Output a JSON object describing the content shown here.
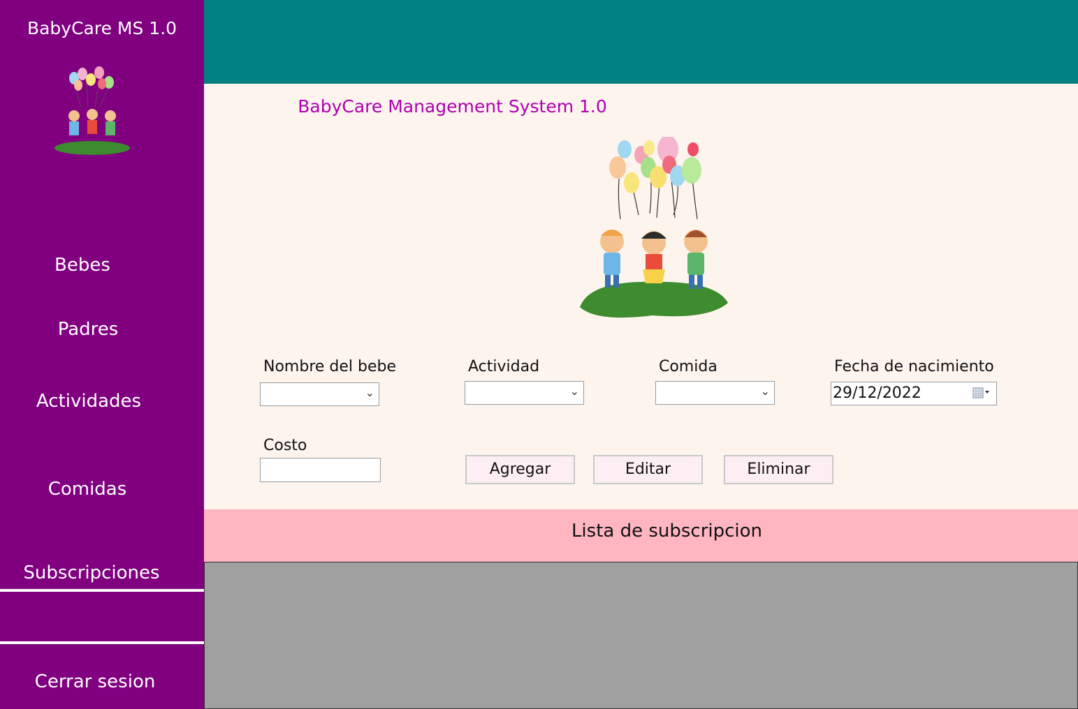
{
  "sidebar": {
    "app_title": "BabyCare MS 1.0",
    "items": [
      {
        "label": "Bebes"
      },
      {
        "label": "Padres"
      },
      {
        "label": "Actividades"
      },
      {
        "label": "Comidas"
      },
      {
        "label": "Subscripciones"
      },
      {
        "label": "Cerrar sesion"
      }
    ]
  },
  "main": {
    "title": "BabyCare Management System 1.0",
    "form": {
      "baby_name_label": "Nombre del bebe",
      "activity_label": "Actividad",
      "food_label": "Comida",
      "birth_date_label": "Fecha de nacimiento",
      "birth_date_value": "29/12/2022",
      "cost_label": "Costo",
      "cost_value": "",
      "add_button": "Agregar",
      "edit_button": "Editar",
      "delete_button": "Eliminar"
    }
  },
  "list": {
    "title": "Lista de subscripcion"
  },
  "colors": {
    "sidebar": "#800080",
    "topbar": "#008080",
    "main_bg": "#fdf4ee",
    "list_header": "#ffb6c1",
    "grid": "#a0a0a0",
    "title_accent": "#b000b0"
  },
  "icons": [
    "kids-balloons-logo",
    "kids-balloons-illustration",
    "chevron-down-icon",
    "calendar-icon"
  ]
}
